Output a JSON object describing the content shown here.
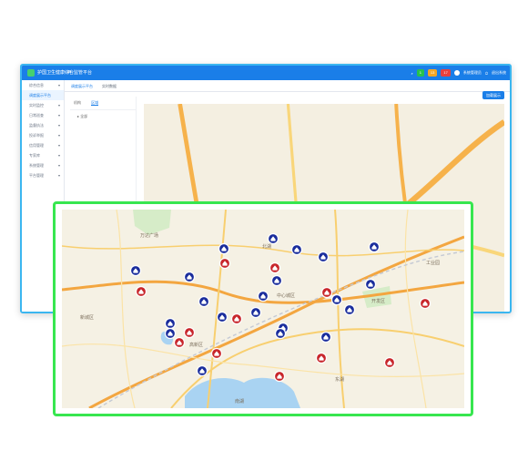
{
  "app": {
    "title": "护国卫生健康综合监管平台",
    "header_right": {
      "badge1": "1",
      "badge2": "13",
      "badge3": "17",
      "user": "系统管理员",
      "logout": "退出系统"
    },
    "colors": {
      "accent": "#1a7ee8",
      "frame_blue": "#3bb6f0",
      "frame_green": "#37e64f",
      "marker_blue": "#1a2d9c",
      "marker_red": "#c8262b"
    }
  },
  "sidebar": {
    "items": [
      {
        "label": "综合信息",
        "active": false
      },
      {
        "label": "调度展示平台",
        "active": true
      },
      {
        "label": "实时监控",
        "active": false
      },
      {
        "label": "日常巡查",
        "active": false
      },
      {
        "label": "监督执法",
        "active": false
      },
      {
        "label": "投诉举报",
        "active": false
      },
      {
        "label": "信用管理",
        "active": false
      },
      {
        "label": "专家库",
        "active": false
      },
      {
        "label": "系统管理",
        "active": false
      },
      {
        "label": "平台管理",
        "active": false
      }
    ]
  },
  "tabs": [
    {
      "label": "调度展示平台",
      "active": true
    },
    {
      "label": "实时数据",
      "active": false
    }
  ],
  "tree": {
    "tabs": [
      "机构",
      "区域"
    ],
    "active_tab": "区域",
    "root": "全部"
  },
  "load_button": "加载展示",
  "map": {
    "place_labels": [
      "万达广场",
      "北湖",
      "中心城区",
      "开发区",
      "高新区",
      "东湖",
      "南湖",
      "新城区",
      "工业园"
    ],
    "markers": [
      {
        "type": "blue"
      },
      {
        "type": "blue"
      },
      {
        "type": "blue"
      },
      {
        "type": "blue"
      },
      {
        "type": "blue"
      },
      {
        "type": "blue"
      },
      {
        "type": "blue"
      },
      {
        "type": "blue"
      },
      {
        "type": "blue"
      },
      {
        "type": "blue"
      },
      {
        "type": "blue"
      },
      {
        "type": "blue"
      },
      {
        "type": "blue"
      },
      {
        "type": "blue"
      },
      {
        "type": "blue"
      },
      {
        "type": "blue"
      },
      {
        "type": "blue"
      },
      {
        "type": "blue"
      },
      {
        "type": "blue"
      },
      {
        "type": "blue"
      },
      {
        "type": "blue"
      },
      {
        "type": "red"
      },
      {
        "type": "red"
      },
      {
        "type": "red"
      },
      {
        "type": "red"
      },
      {
        "type": "red"
      },
      {
        "type": "red"
      },
      {
        "type": "red"
      },
      {
        "type": "red"
      },
      {
        "type": "red"
      },
      {
        "type": "red"
      },
      {
        "type": "red"
      },
      {
        "type": "red"
      }
    ]
  }
}
